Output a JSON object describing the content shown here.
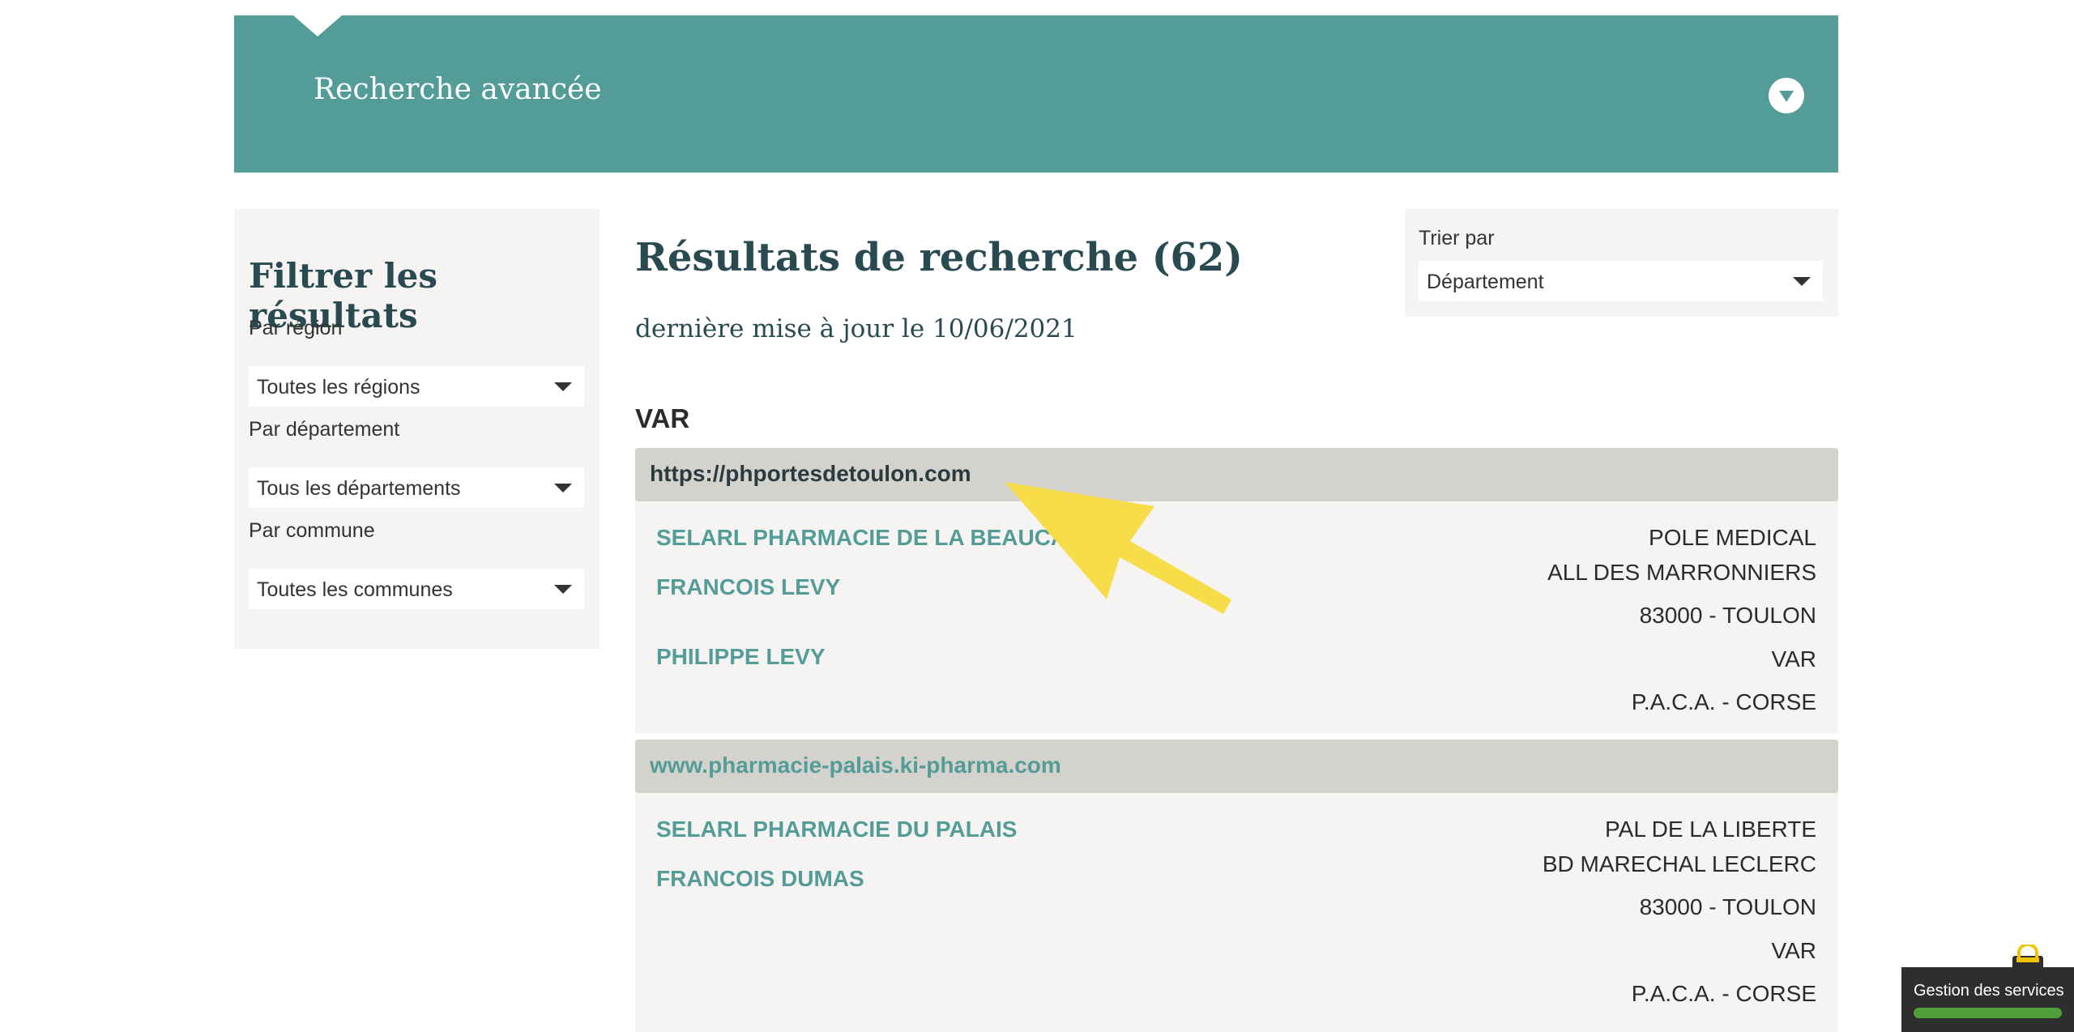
{
  "header": {
    "title": "Recherche avancée"
  },
  "filters": {
    "title": "Filtrer les résultats",
    "region": {
      "label": "Par région",
      "value": "Toutes les régions"
    },
    "departement": {
      "label": "Par département",
      "value": "Tous les départements"
    },
    "commune": {
      "label": "Par commune",
      "value": "Toutes les communes"
    }
  },
  "results": {
    "title": "Résultats de recherche (62)",
    "updated": "dernière mise à jour le 10/06/2021",
    "sort": {
      "label": "Trier par",
      "value": "Département"
    },
    "group": "VAR",
    "cards": [
      {
        "url": "https://phportesdetoulon.com",
        "names": [
          "SELARL PHARMACIE DE LA BEAUCA",
          "FRANCOIS LEVY",
          "PHILIPPE LEVY"
        ],
        "address": [
          "POLE MEDICAL",
          "ALL DES MARRONNIERS",
          "83000 - TOULON",
          "VAR",
          "P.A.C.A. - CORSE"
        ]
      },
      {
        "url": "www.pharmacie-palais.ki-pharma.com",
        "names": [
          "SELARL PHARMACIE DU PALAIS",
          "FRANCOIS DUMAS"
        ],
        "address": [
          "PAL DE LA LIBERTE",
          "BD MARECHAL LECLERC",
          "83000 - TOULON",
          "VAR",
          "P.A.C.A. - CORSE"
        ]
      }
    ]
  },
  "cookie_widget": {
    "label": "Gestion des services"
  },
  "colors": {
    "teal": "#549c98",
    "dark_teal": "#2a4a52",
    "card_bg": "#f5f4f2",
    "card_head_bg": "#d3d2cd",
    "arrow_yellow": "#f8dd4a",
    "cookie_green": "#4fa03c"
  },
  "icons": {
    "banner_toggle": "chevron-down-icon",
    "select_caret": "caret-down-icon",
    "pointer": "arrow-pointer-icon",
    "cookie_lock": "lock-icon"
  }
}
